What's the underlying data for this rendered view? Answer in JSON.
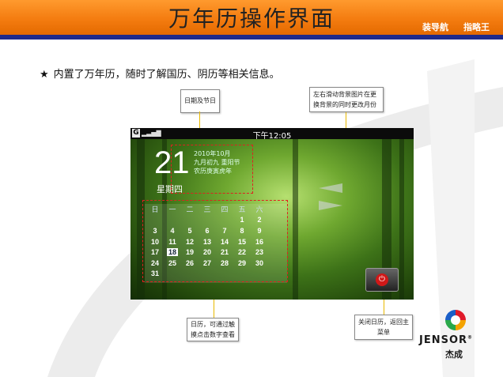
{
  "header": {
    "title": "万年历操作界面",
    "nav": [
      "装导航",
      "指略王"
    ]
  },
  "bullet": {
    "star": "★",
    "text": "内置了万年历，随时了解国历、阴历等相关信息。"
  },
  "callouts": {
    "date_holiday": "日期及节日",
    "swipe_bg": "左右滑动背景图片在更换背景的同时更改月份",
    "calendar_touch": "日历，可通过触摸点击数字查看",
    "close": "关闭日历，返回主菜单"
  },
  "phone": {
    "status_time": "下午12:05",
    "g_icon": "G",
    "day_number": "21",
    "weekday": "星期四",
    "date_lines": [
      "2010年10月",
      "九月初九 重阳节",
      "农历庚寅虎年"
    ],
    "calendar_headers": [
      "日",
      "一",
      "二",
      "三",
      "四",
      "五",
      "六"
    ],
    "calendar_rows": [
      [
        "",
        "",
        "",
        "",
        "",
        "1",
        "2"
      ],
      [
        "3",
        "4",
        "5",
        "6",
        "7",
        "8",
        "9"
      ],
      [
        "10",
        "11",
        "12",
        "13",
        "14",
        "15",
        "16"
      ],
      [
        "17",
        "18",
        "19",
        "20",
        "21",
        "22",
        "23"
      ],
      [
        "24",
        "25",
        "26",
        "27",
        "28",
        "29",
        "30"
      ],
      [
        "31",
        "",
        "",
        "",
        "",
        "",
        ""
      ]
    ],
    "today": "18"
  },
  "logo": {
    "name": "JENSOR",
    "reg": "®",
    "cn": "杰成"
  },
  "colors": {
    "header": "#f47c10",
    "header_line": "#1f2a8a",
    "marker": "#e8b800",
    "red_box": "#e02020"
  }
}
